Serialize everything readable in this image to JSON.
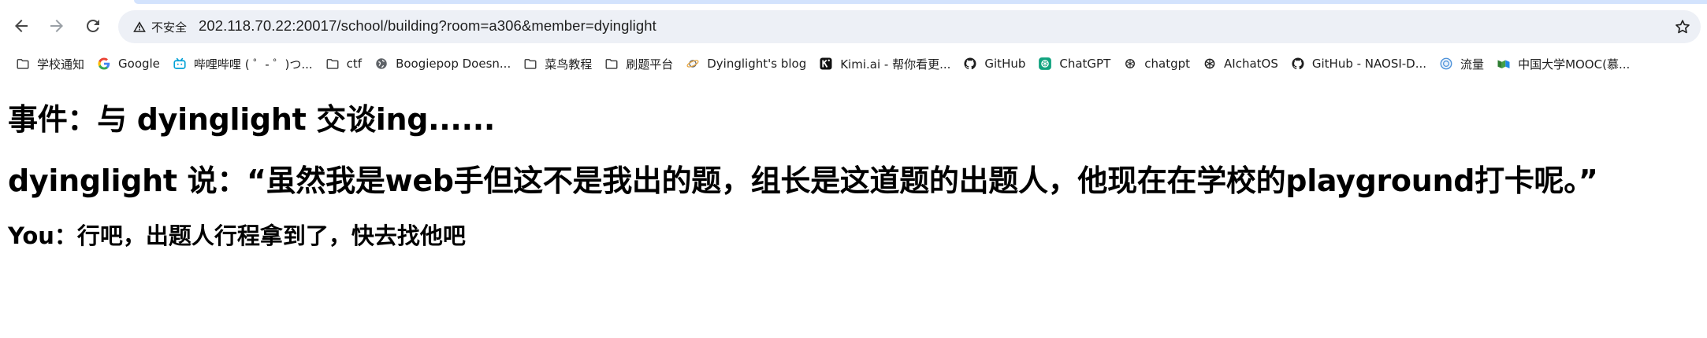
{
  "browser": {
    "security_label": "不安全",
    "url": "202.118.70.22:20017/school/building?room=a306&member=dyinglight",
    "icons": {
      "back": "arrow-left-icon",
      "forward": "arrow-right-icon",
      "reload": "reload-icon",
      "security": "warning-triangle-icon",
      "bookmark_star": "star-icon"
    }
  },
  "bookmarks": [
    {
      "label": "学校通知",
      "icon": "folder-icon"
    },
    {
      "label": "Google",
      "icon": "google-icon"
    },
    {
      "label": "哔哩哔哩 ( ゜- ゜)つ...",
      "icon": "bilibili-icon"
    },
    {
      "label": "ctf",
      "icon": "folder-icon"
    },
    {
      "label": "Boogiepop Doesn...",
      "icon": "globe-icon"
    },
    {
      "label": "菜鸟教程",
      "icon": "folder-icon"
    },
    {
      "label": "刷题平台",
      "icon": "folder-icon"
    },
    {
      "label": "Dyinglight's blog",
      "icon": "planet-icon"
    },
    {
      "label": "Kimi.ai - 帮你看更...",
      "icon": "kimi-icon"
    },
    {
      "label": "GitHub",
      "icon": "github-icon"
    },
    {
      "label": "ChatGPT",
      "icon": "chatgpt-icon"
    },
    {
      "label": "chatgpt",
      "icon": "openai-icon"
    },
    {
      "label": "AIchatOS",
      "icon": "openai-icon"
    },
    {
      "label": "GitHub - NAOSI-D...",
      "icon": "github-icon"
    },
    {
      "label": "流量",
      "icon": "circle-logo-icon"
    },
    {
      "label": "中国大学MOOC(慕...",
      "icon": "mooc-icon"
    }
  ],
  "page": {
    "event_heading": "事件：与 dyinglight 交谈ing......",
    "dialogue_heading": "dyinglight 说：“虽然我是web手但这不是我出的题，组长是这道题的出题人，他现在在学校的playground打卡呢。”",
    "reply": "You：行吧，出题人行程拿到了，快去找他吧"
  },
  "colors": {
    "omnibox_bg": "#edf0f6",
    "tab_strip": "#d3e3fd",
    "chatgpt_green": "#10a37f",
    "bilibili_blue": "#00a1d6"
  }
}
